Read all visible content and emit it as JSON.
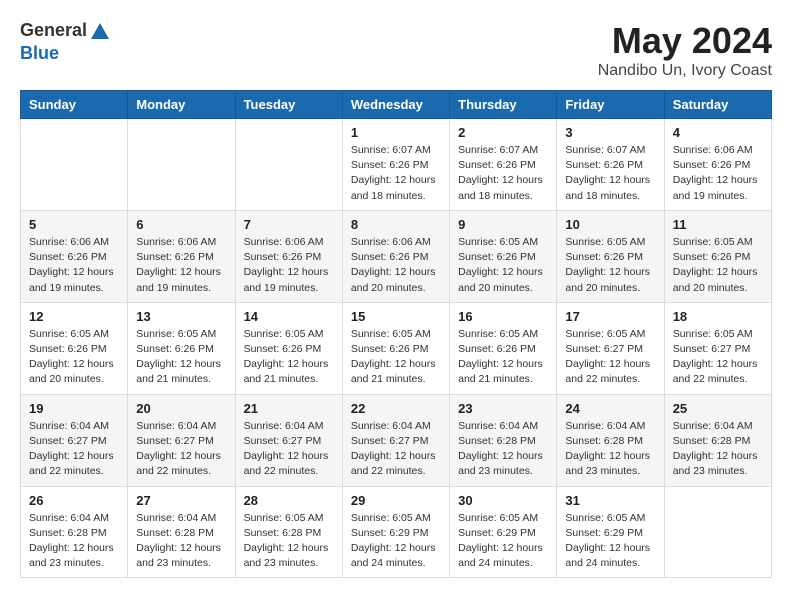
{
  "header": {
    "logo_general": "General",
    "logo_blue": "Blue",
    "month_title": "May 2024",
    "location": "Nandibo Un, Ivory Coast"
  },
  "weekdays": [
    "Sunday",
    "Monday",
    "Tuesday",
    "Wednesday",
    "Thursday",
    "Friday",
    "Saturday"
  ],
  "weeks": [
    [
      {
        "day": "",
        "info": ""
      },
      {
        "day": "",
        "info": ""
      },
      {
        "day": "",
        "info": ""
      },
      {
        "day": "1",
        "info": "Sunrise: 6:07 AM\nSunset: 6:26 PM\nDaylight: 12 hours\nand 18 minutes."
      },
      {
        "day": "2",
        "info": "Sunrise: 6:07 AM\nSunset: 6:26 PM\nDaylight: 12 hours\nand 18 minutes."
      },
      {
        "day": "3",
        "info": "Sunrise: 6:07 AM\nSunset: 6:26 PM\nDaylight: 12 hours\nand 18 minutes."
      },
      {
        "day": "4",
        "info": "Sunrise: 6:06 AM\nSunset: 6:26 PM\nDaylight: 12 hours\nand 19 minutes."
      }
    ],
    [
      {
        "day": "5",
        "info": "Sunrise: 6:06 AM\nSunset: 6:26 PM\nDaylight: 12 hours\nand 19 minutes."
      },
      {
        "day": "6",
        "info": "Sunrise: 6:06 AM\nSunset: 6:26 PM\nDaylight: 12 hours\nand 19 minutes."
      },
      {
        "day": "7",
        "info": "Sunrise: 6:06 AM\nSunset: 6:26 PM\nDaylight: 12 hours\nand 19 minutes."
      },
      {
        "day": "8",
        "info": "Sunrise: 6:06 AM\nSunset: 6:26 PM\nDaylight: 12 hours\nand 20 minutes."
      },
      {
        "day": "9",
        "info": "Sunrise: 6:05 AM\nSunset: 6:26 PM\nDaylight: 12 hours\nand 20 minutes."
      },
      {
        "day": "10",
        "info": "Sunrise: 6:05 AM\nSunset: 6:26 PM\nDaylight: 12 hours\nand 20 minutes."
      },
      {
        "day": "11",
        "info": "Sunrise: 6:05 AM\nSunset: 6:26 PM\nDaylight: 12 hours\nand 20 minutes."
      }
    ],
    [
      {
        "day": "12",
        "info": "Sunrise: 6:05 AM\nSunset: 6:26 PM\nDaylight: 12 hours\nand 20 minutes."
      },
      {
        "day": "13",
        "info": "Sunrise: 6:05 AM\nSunset: 6:26 PM\nDaylight: 12 hours\nand 21 minutes."
      },
      {
        "day": "14",
        "info": "Sunrise: 6:05 AM\nSunset: 6:26 PM\nDaylight: 12 hours\nand 21 minutes."
      },
      {
        "day": "15",
        "info": "Sunrise: 6:05 AM\nSunset: 6:26 PM\nDaylight: 12 hours\nand 21 minutes."
      },
      {
        "day": "16",
        "info": "Sunrise: 6:05 AM\nSunset: 6:26 PM\nDaylight: 12 hours\nand 21 minutes."
      },
      {
        "day": "17",
        "info": "Sunrise: 6:05 AM\nSunset: 6:27 PM\nDaylight: 12 hours\nand 22 minutes."
      },
      {
        "day": "18",
        "info": "Sunrise: 6:05 AM\nSunset: 6:27 PM\nDaylight: 12 hours\nand 22 minutes."
      }
    ],
    [
      {
        "day": "19",
        "info": "Sunrise: 6:04 AM\nSunset: 6:27 PM\nDaylight: 12 hours\nand 22 minutes."
      },
      {
        "day": "20",
        "info": "Sunrise: 6:04 AM\nSunset: 6:27 PM\nDaylight: 12 hours\nand 22 minutes."
      },
      {
        "day": "21",
        "info": "Sunrise: 6:04 AM\nSunset: 6:27 PM\nDaylight: 12 hours\nand 22 minutes."
      },
      {
        "day": "22",
        "info": "Sunrise: 6:04 AM\nSunset: 6:27 PM\nDaylight: 12 hours\nand 22 minutes."
      },
      {
        "day": "23",
        "info": "Sunrise: 6:04 AM\nSunset: 6:28 PM\nDaylight: 12 hours\nand 23 minutes."
      },
      {
        "day": "24",
        "info": "Sunrise: 6:04 AM\nSunset: 6:28 PM\nDaylight: 12 hours\nand 23 minutes."
      },
      {
        "day": "25",
        "info": "Sunrise: 6:04 AM\nSunset: 6:28 PM\nDaylight: 12 hours\nand 23 minutes."
      }
    ],
    [
      {
        "day": "26",
        "info": "Sunrise: 6:04 AM\nSunset: 6:28 PM\nDaylight: 12 hours\nand 23 minutes."
      },
      {
        "day": "27",
        "info": "Sunrise: 6:04 AM\nSunset: 6:28 PM\nDaylight: 12 hours\nand 23 minutes."
      },
      {
        "day": "28",
        "info": "Sunrise: 6:05 AM\nSunset: 6:28 PM\nDaylight: 12 hours\nand 23 minutes."
      },
      {
        "day": "29",
        "info": "Sunrise: 6:05 AM\nSunset: 6:29 PM\nDaylight: 12 hours\nand 24 minutes."
      },
      {
        "day": "30",
        "info": "Sunrise: 6:05 AM\nSunset: 6:29 PM\nDaylight: 12 hours\nand 24 minutes."
      },
      {
        "day": "31",
        "info": "Sunrise: 6:05 AM\nSunset: 6:29 PM\nDaylight: 12 hours\nand 24 minutes."
      },
      {
        "day": "",
        "info": ""
      }
    ]
  ]
}
